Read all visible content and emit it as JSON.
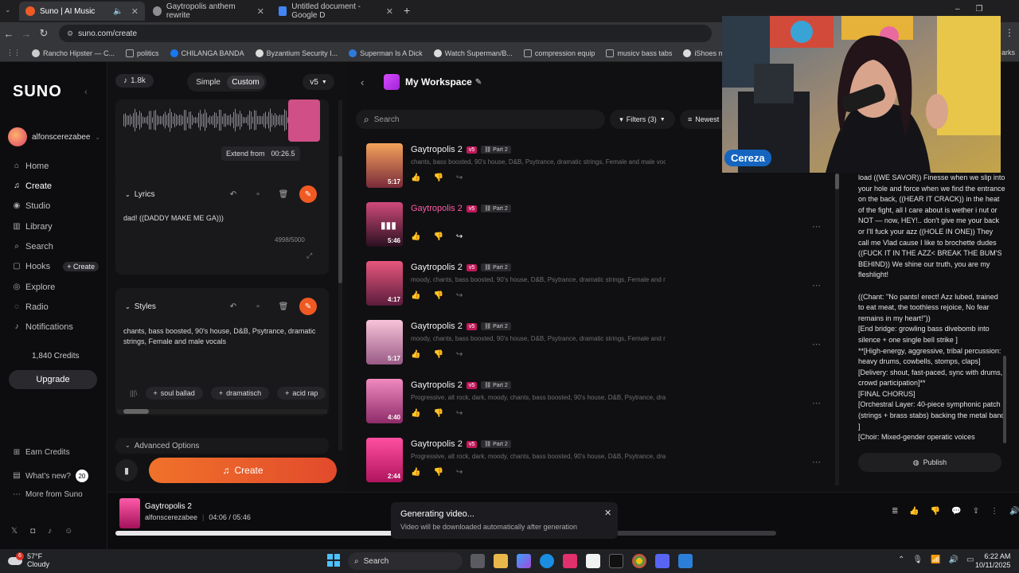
{
  "browser": {
    "tabs": [
      {
        "title": "Suno | AI Music",
        "color": "#ef5a24"
      },
      {
        "title": "Gaytropolis anthem rewrite",
        "color": "#8e8e93"
      },
      {
        "title": "Untitled document - Google D",
        "color": "#4285f4"
      }
    ],
    "url": "suno.com/create",
    "bookmarks": [
      "Rancho Hipster — C...",
      "politics",
      "CHILANGA BANDA",
      "Byzantium Security I...",
      "Superman Is A Dick",
      "Watch Superman/B...",
      "compression equip",
      "musicv bass tabs",
      "iShoes motorized sk...",
      "arks"
    ]
  },
  "sidebar": {
    "logo": "SUNO",
    "username": "alfonscerezabee",
    "nav": [
      "Home",
      "Create",
      "Studio",
      "Library",
      "Search",
      "Hooks",
      "Explore",
      "Radio",
      "Notifications"
    ],
    "hooks_create": "+ Create",
    "credits": "1,840 Credits",
    "upgrade": "Upgrade",
    "earn_credits": "Earn Credits",
    "whats_new": "What's new?",
    "whats_new_count": "20",
    "more_from": "More from Suno"
  },
  "create": {
    "credit_pill": "1.8k",
    "mode_simple": "Simple",
    "mode_custom": "Custom",
    "model": "v5",
    "extend_label": "Extend from",
    "extend_time": "00:26.5",
    "lyrics_title": "Lyrics",
    "lyrics_text": "dad! ((DADDY MAKE ME GA)))",
    "lyrics_count": "4998/5000",
    "styles_title": "Styles",
    "styles_text": "chants, bass boosted, 90's house, D&B, Psytrance, dramatic strings, Female and male vocals",
    "style_chips": [
      "soul ballad",
      "dramatisch",
      "acid rap"
    ],
    "advanced": "Advanced Options",
    "create_button": "Create"
  },
  "workspace": {
    "title": "My Workspace",
    "search_placeholder": "Search",
    "filters": "Filters (3)",
    "sort": "Newest",
    "songs": [
      {
        "title": "Gaytropolis 2",
        "tag": "v5",
        "part": "Part 2",
        "desc": "chants, bass boosted, 90's house, D&B, Psytrance, dramatic strings, Female and male vocals",
        "duration": "5:17",
        "c1": "#f4a35b",
        "c2": "#7a2a3a",
        "highlight": false
      },
      {
        "title": "Gaytropolis 2",
        "tag": "v5",
        "part": "Part 2",
        "desc": "",
        "duration": "5:46",
        "c1": "#d04a7a",
        "c2": "#2a1020",
        "highlight": true
      },
      {
        "title": "Gaytropolis 2",
        "tag": "v5",
        "part": "Part 2",
        "desc": "moody, chants, bass boosted, 90's house, D&B, Psytrance, dramatic strings, Female and mal...",
        "duration": "4:17",
        "c1": "#e8577e",
        "c2": "#5b1c3c",
        "highlight": false
      },
      {
        "title": "Gaytropolis 2",
        "tag": "v5",
        "part": "Part 2",
        "desc": "moody, chants, bass boosted, 90's house, D&B, Psytrance, dramatic strings, Female and mal...",
        "duration": "5:17",
        "c1": "#f7c4d8",
        "c2": "#9a5a86",
        "highlight": false
      },
      {
        "title": "Gaytropolis 2",
        "tag": "v5",
        "part": "Part 2",
        "desc": "Progressive, alt rock, dark, moody, chants, bass boosted, 90's house, D&B, Psytrance, drama...",
        "duration": "4:40",
        "c1": "#f08abf",
        "c2": "#8e2c6a",
        "highlight": false
      },
      {
        "title": "Gaytropolis 2",
        "tag": "v5",
        "part": "Part 2",
        "desc": "Progressive, alt rock, dark, moody, chants, bass boosted, 90's house, D&B, Psytrance, drama...",
        "duration": "2:44",
        "c1": "#ff4fa0",
        "c2": "#b0145e",
        "highlight": false
      }
    ]
  },
  "webcam": {
    "name": "Cereza"
  },
  "lyrics_panel": {
    "text": "load ((WE SAVOR)) Finesse when we slip into your hole and force when we find the entrance on the back, ((HEAR IT CRACK)) in the heat of the fight, all I care about is wether i nut or NOT — now, HEY!.. don't give me your back or I'll fuck your azz ((HOLE IN ONE)) They call me Vlad cause I like to brochette dudes ((FUCK IT IN THE AZZ< BREAK THE BUM'S BEHIND)) We shine our truth, you are my fleshlight!\n\n((Chant: \"No pants! erect! Azz lubed, trained to eat meat, the toothless rejoice, No fear remains in my heart!\"))\n[End bridge: growling bass divebomb into silence + one single bell strike ]\n**[High-energy, aggressive, tribal percussion: heavy drums, cowbells, stomps, claps] [Delivery: shout, fast-paced, sync with drums, crowd participation]**\n[FINAL CHORUS]\n[Orchestral Layer: 40-piece symphonic patch (strings + brass stabs) backing the metal band ]\n[Choir: Mixed-gender operatic voices",
    "publish": "Publish"
  },
  "player": {
    "title": "Gaytropolis 2",
    "artist": "alfonscerezabee",
    "time": "04:06 / 05:46",
    "progress": 0.71,
    "toast_title": "Generating video...",
    "toast_sub": "Video will be downloaded automatically after generation"
  },
  "taskbar": {
    "weather_temp": "57°F",
    "weather_desc": "Cloudy",
    "weather_badge": "6",
    "search": "Search",
    "time": "6:22 AM",
    "date": "10/11/2025"
  }
}
